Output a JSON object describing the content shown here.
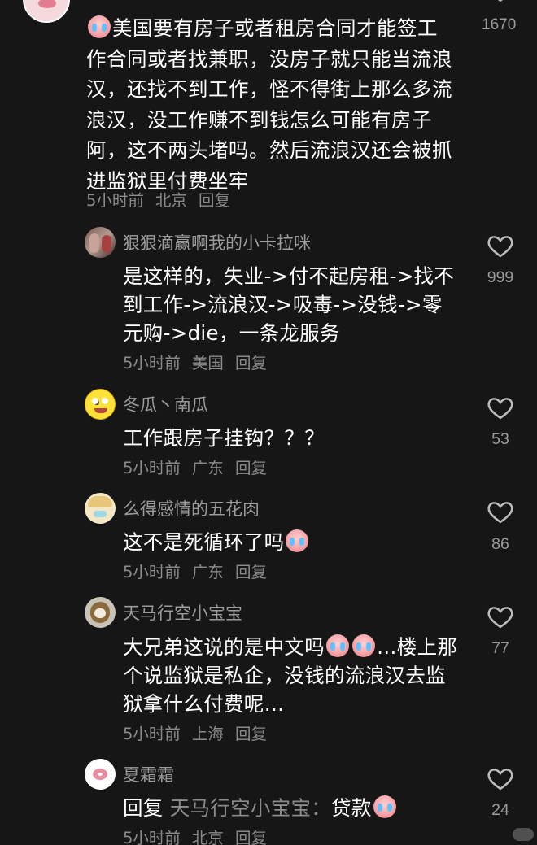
{
  "main_comment": {
    "text": "美国要有房子或者租房合同才能签工作合同或者找兼职，没房子就只能当流浪汉，还找不到工作，怪不得街上那么多流浪汉，没工作赚不到钱怎么可能有房子阿，这不两头堵吗。然后流浪汉还会被抓进监狱里付费坐牢",
    "time": "5小时前",
    "location": "北京",
    "reply_label": "回复",
    "likes": "1670",
    "leading_emoji": "crying-face-emoji"
  },
  "replies": [
    {
      "username": "狠狠滴赢啊我的小卡拉咪",
      "text": "是这样的，失业->付不起房租->找不到工作->流浪汉->吸毒->没钱->零元购->die，一条龙服务",
      "time": "5小时前",
      "location": "美国",
      "reply_label": "回复",
      "likes": "999"
    },
    {
      "username": "冬瓜丶南瓜",
      "text": "工作跟房子挂钩？？？",
      "time": "5小时前",
      "location": "广东",
      "reply_label": "回复",
      "likes": "53"
    },
    {
      "username": "么得感情的五花肉",
      "text": "这不是死循环了吗",
      "time": "5小时前",
      "location": "广东",
      "reply_label": "回复",
      "likes": "86"
    },
    {
      "username": "天马行空小宝宝",
      "text_a": "大兄弟这说的是中文吗",
      "text_b": "…楼上那个说监狱是私企，没钱的流浪汉去监狱拿什么付费呢…",
      "time": "5小时前",
      "location": "上海",
      "reply_label": "回复",
      "likes": "77"
    },
    {
      "username": "夏霜霜",
      "prefix": "回复",
      "mention": "天马行空小宝宝：",
      "text": "贷款",
      "time": "5小时前",
      "location": "北京",
      "reply_label": "回复",
      "likes": "24"
    }
  ],
  "icons": {
    "like": "heart-outline-icon",
    "emoji": "crying-face-emoji"
  },
  "colors": {
    "background": "#161616",
    "primary_text": "#ffffff",
    "secondary_text": "#8b8b8b"
  }
}
